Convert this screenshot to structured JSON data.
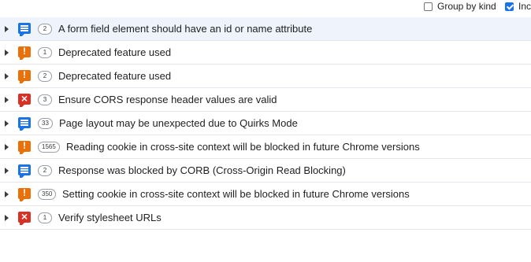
{
  "toolbar": {
    "group_by_kind_label": "Group by kind",
    "group_by_kind_checked": false,
    "include_label": "Inc",
    "include_checked": true
  },
  "issues": [
    {
      "kind": "info",
      "count": "2",
      "message": "A form field element should have an id or name attribute",
      "selected": true
    },
    {
      "kind": "warn",
      "count": "1",
      "message": "Deprecated feature used"
    },
    {
      "kind": "warn",
      "count": "2",
      "message": "Deprecated feature used"
    },
    {
      "kind": "error",
      "count": "3",
      "message": "Ensure CORS response header values are valid"
    },
    {
      "kind": "info",
      "count": "33",
      "message": "Page layout may be unexpected due to Quirks Mode"
    },
    {
      "kind": "warn",
      "count": "1565",
      "message": "Reading cookie in cross-site context will be blocked in future Chrome versions"
    },
    {
      "kind": "info",
      "count": "2",
      "message": "Response was blocked by CORB (Cross-Origin Read Blocking)"
    },
    {
      "kind": "warn",
      "count": "350",
      "message": "Setting cookie in cross-site context will be blocked in future Chrome versions"
    },
    {
      "kind": "error",
      "count": "1",
      "message": "Verify stylesheet URLs"
    }
  ],
  "icons": {
    "info": "info-message-icon",
    "warn": "warning-icon",
    "error": "error-icon",
    "expand": "expand-arrow-icon"
  },
  "colors": {
    "info": "#1a73e8",
    "warn": "#e8710a",
    "error": "#d93025",
    "selected_row": "#eef3fc"
  }
}
